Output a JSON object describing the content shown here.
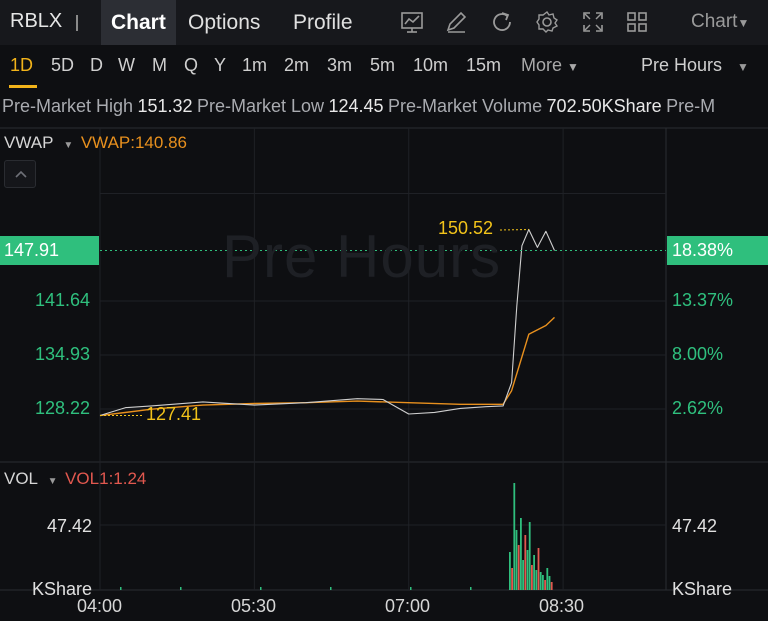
{
  "header": {
    "symbol": "RBLX",
    "tabs": [
      {
        "label": "Chart",
        "active": true
      },
      {
        "label": "Options",
        "active": false
      },
      {
        "label": "Profile",
        "active": false
      }
    ],
    "tools": [
      "chart-indicator-icon",
      "draw-pen-icon",
      "refresh-icon",
      "settings-gear-icon",
      "fullscreen-icon",
      "layout-grid-icon"
    ],
    "chart_menu_label": "Chart"
  },
  "periods": {
    "items": [
      "1D",
      "5D",
      "D",
      "W",
      "M",
      "Q",
      "Y",
      "1m",
      "2m",
      "3m",
      "5m",
      "10m",
      "15m"
    ],
    "active": "1D",
    "more_label": "More",
    "session_label": "Pre Hours"
  },
  "info": {
    "high_label": "Pre-Market High",
    "high_value": "151.32",
    "low_label": "Pre-Market Low",
    "low_value": "124.45",
    "volume_label": "Pre-Market Volume",
    "volume_value": "702.50KShare",
    "trailing": "Pre-M"
  },
  "main_panel": {
    "indicator_name": "VWAP",
    "indicator_value": "VWAP:140.86",
    "watermark": "Pre Hours",
    "price_labels_left": [
      "141.64",
      "134.93",
      "128.22"
    ],
    "percent_labels_right": [
      "13.37%",
      "8.00%",
      "2.62%"
    ],
    "current_price": "147.91",
    "current_percent": "18.38%",
    "annotation_high": "150.52",
    "annotation_low": "127.41"
  },
  "volume_panel": {
    "indicator_name": "VOL",
    "indicator_value": "VOL1:1.24",
    "left_value": "47.42",
    "left_unit": "KShare",
    "right_value": "47.42",
    "right_unit": "KShare"
  },
  "time_axis": [
    "04:00",
    "05:30",
    "07:00",
    "08:30"
  ],
  "colors": {
    "up": "#2fbf7d",
    "down": "#e2584f",
    "vwap": "#e8901e",
    "accent": "#f2b31a",
    "price_line": "#cfcfcf"
  },
  "chart_data": {
    "type": "line",
    "x_range": [
      "04:00",
      "09:30"
    ],
    "y_range": [
      124.45,
      151.32
    ],
    "series": [
      {
        "name": "VWAP",
        "points": [
          [
            "04:00",
            127.4
          ],
          [
            "04:30",
            128.2
          ],
          [
            "05:00",
            128.7
          ],
          [
            "05:30",
            128.9
          ],
          [
            "06:00",
            129.0
          ],
          [
            "06:30",
            129.2
          ],
          [
            "07:00",
            129.0
          ],
          [
            "07:30",
            128.8
          ],
          [
            "07:55",
            128.8
          ],
          [
            "08:00",
            130.5
          ],
          [
            "08:05",
            134.0
          ],
          [
            "08:10",
            137.5
          ],
          [
            "08:20",
            138.6
          ],
          [
            "08:25",
            139.6
          ]
        ]
      },
      {
        "name": "Price",
        "points": [
          [
            "04:00",
            127.41
          ],
          [
            "04:15",
            128.4
          ],
          [
            "04:30",
            128.6
          ],
          [
            "05:00",
            129.1
          ],
          [
            "05:30",
            128.7
          ],
          [
            "06:00",
            129.0
          ],
          [
            "06:30",
            129.5
          ],
          [
            "06:45",
            129.4
          ],
          [
            "07:00",
            127.6
          ],
          [
            "07:15",
            127.8
          ],
          [
            "07:30",
            128.3
          ],
          [
            "07:45",
            128.5
          ],
          [
            "07:55",
            128.6
          ],
          [
            "08:00",
            131.5
          ],
          [
            "08:03",
            141.0
          ],
          [
            "08:06",
            148.5
          ],
          [
            "08:10",
            150.52
          ],
          [
            "08:15",
            148.3
          ],
          [
            "08:20",
            150.3
          ],
          [
            "08:25",
            147.91
          ]
        ]
      }
    ],
    "volume_unit": "KShare",
    "volume_max_label": 47.42
  }
}
